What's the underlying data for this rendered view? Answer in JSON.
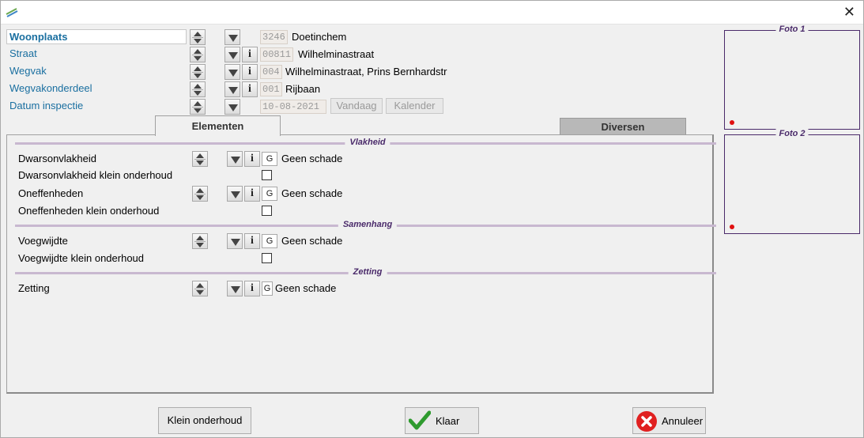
{
  "icons": {
    "app": "app-logo-icon",
    "close": "close-icon"
  },
  "fields": [
    {
      "label": "Woonplaats",
      "code": "3246",
      "value": "Doetinchem",
      "info": false
    },
    {
      "label": "Straat",
      "code": "00811",
      "value": "Wilhelminastraat",
      "info": true
    },
    {
      "label": "Wegvak",
      "code": "004",
      "value": "Wilhelminastraat, Prins Bernhardstr",
      "info": true
    },
    {
      "label": "Wegvakonderdeel",
      "code": "001",
      "value": "Rijbaan",
      "info": true
    },
    {
      "label": "Datum inspectie",
      "code": "10-08-2021",
      "value": "",
      "info": false
    }
  ],
  "date_buttons": {
    "today": "Vandaag",
    "calendar": "Kalender"
  },
  "tabs": [
    {
      "label": "Elementen",
      "active": true
    },
    {
      "label": "Diversen",
      "active": false
    }
  ],
  "sections": [
    {
      "title": "Vlakheid"
    },
    {
      "title": "Samenhang"
    },
    {
      "title": "Zetting"
    }
  ],
  "elements": [
    {
      "label": "Dwarsonvlakheid",
      "code": "G",
      "value": "Geen schade"
    },
    {
      "label": "Dwarsonvlakheid klein onderhoud",
      "checked": false
    },
    {
      "label": "Oneffenheden",
      "code": "G",
      "value": "Geen schade"
    },
    {
      "label": "Oneffenheden klein onderhoud",
      "checked": false
    },
    {
      "label": "Voegwijdte",
      "code": "G",
      "value": "Geen schade"
    },
    {
      "label": "Voegwijdte klein onderhoud",
      "checked": false
    },
    {
      "label": "Zetting",
      "code": "G",
      "value": "Geen schade"
    }
  ],
  "photos": [
    {
      "title": "Foto 1"
    },
    {
      "title": "Foto 2"
    }
  ],
  "buttons": {
    "klein": "Klein onderhoud",
    "klaar": "Klaar",
    "annuleer": "Annuleer"
  },
  "colors": {
    "label_blue": "#1a6fa0",
    "section_purple": "#4a2a6a",
    "ok_green": "#2e9a2e",
    "cancel_red": "#e02020"
  }
}
